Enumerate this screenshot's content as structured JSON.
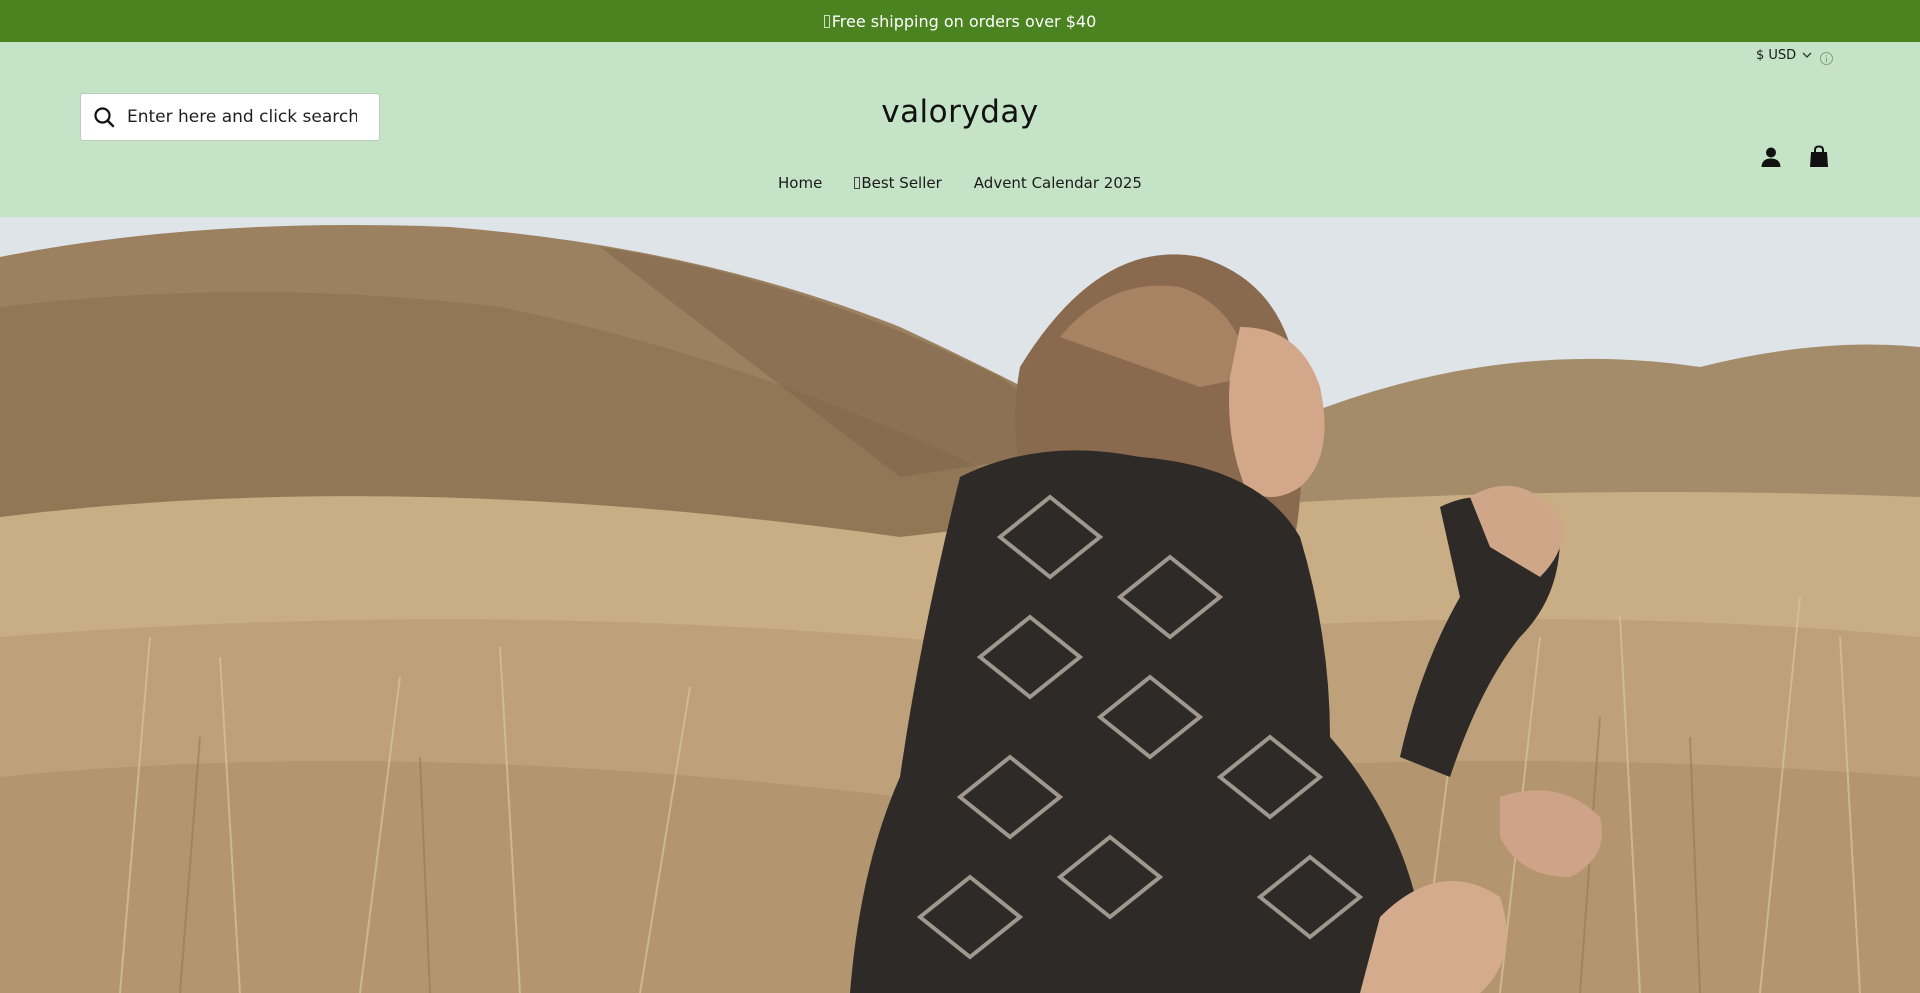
{
  "announcement": {
    "text": "Free shipping on orders over $40"
  },
  "header": {
    "currency": {
      "label": "$ USD"
    },
    "search": {
      "placeholder": "Enter here and click search"
    },
    "logo": "valoryday"
  },
  "nav": {
    "items": [
      {
        "label": "Home"
      },
      {
        "label": "Best Seller"
      },
      {
        "label": "Advent Calendar 2025"
      }
    ]
  },
  "colors": {
    "announcement_bg": "#4a831f",
    "header_bg": "#c5e3c6",
    "text": "#111111"
  },
  "icons": [
    "search-icon",
    "chevron-down-icon",
    "info-icon",
    "account-icon",
    "cart-icon"
  ]
}
